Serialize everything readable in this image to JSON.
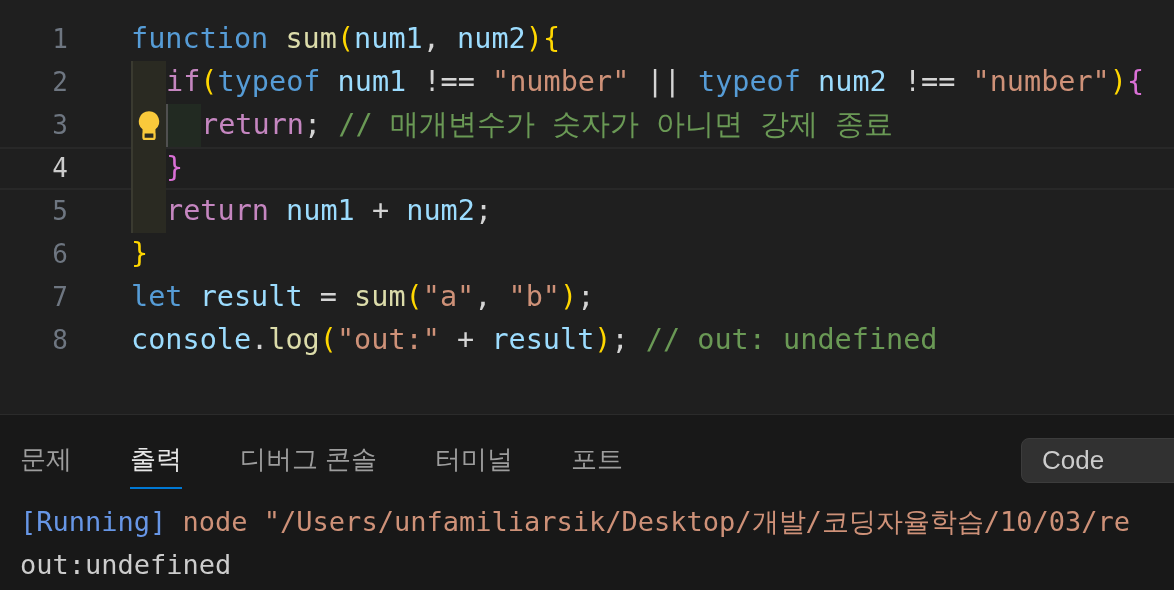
{
  "editor": {
    "lines": [
      {
        "number": "1",
        "current": false,
        "lightbulb": false,
        "tokens": [
          {
            "text": "function ",
            "kind": "keyword"
          },
          {
            "text": "sum",
            "kind": "func"
          },
          {
            "text": "(",
            "kind": "bracket1"
          },
          {
            "text": "num1",
            "kind": "var"
          },
          {
            "text": ", ",
            "kind": "plain"
          },
          {
            "text": "num2",
            "kind": "var"
          },
          {
            "text": ")",
            "kind": "bracket1"
          },
          {
            "text": "{",
            "kind": "bracket1"
          }
        ],
        "children": [
          {
            "number": "2",
            "current": false,
            "lightbulb": false,
            "tokens": [
              {
                "text": "if",
                "kind": "control"
              },
              {
                "text": "(",
                "kind": "bracket1"
              },
              {
                "text": "typeof ",
                "kind": "keyword"
              },
              {
                "text": "num1",
                "kind": "var"
              },
              {
                "text": " !== ",
                "kind": "plain"
              },
              {
                "text": "\"number\"",
                "kind": "string"
              },
              {
                "text": " || ",
                "kind": "plain"
              },
              {
                "text": "typeof ",
                "kind": "keyword"
              },
              {
                "text": "num2",
                "kind": "var"
              },
              {
                "text": " !== ",
                "kind": "plain"
              },
              {
                "text": "\"number\"",
                "kind": "string"
              },
              {
                "text": ")",
                "kind": "bracket1"
              },
              {
                "text": "{",
                "kind": "bracket2"
              }
            ],
            "children": [
              {
                "number": "3",
                "current": false,
                "lightbulb": true,
                "tokens": [
                  {
                    "text": "return",
                    "kind": "control"
                  },
                  {
                    "text": "; ",
                    "kind": "plain"
                  },
                  {
                    "text": "// 매개변수가 숫자가 아니면 강제 종료",
                    "kind": "comment"
                  }
                ]
              }
            ]
          },
          {
            "number": "4",
            "current": true,
            "lightbulb": false,
            "tokens": [
              {
                "text": "}",
                "kind": "bracket2"
              }
            ]
          },
          {
            "number": "5",
            "current": false,
            "lightbulb": false,
            "tokens": [
              {
                "text": "return ",
                "kind": "control"
              },
              {
                "text": "num1",
                "kind": "var"
              },
              {
                "text": " + ",
                "kind": "plain"
              },
              {
                "text": "num2",
                "kind": "var"
              },
              {
                "text": ";",
                "kind": "plain"
              }
            ]
          }
        ]
      },
      {
        "number": "6",
        "current": false,
        "lightbulb": false,
        "tokens": [
          {
            "text": "}",
            "kind": "bracket1"
          }
        ]
      },
      {
        "number": "7",
        "current": false,
        "lightbulb": false,
        "tokens": [
          {
            "text": "let ",
            "kind": "keyword"
          },
          {
            "text": "result",
            "kind": "var"
          },
          {
            "text": " = ",
            "kind": "plain"
          },
          {
            "text": "sum",
            "kind": "func"
          },
          {
            "text": "(",
            "kind": "bracket1"
          },
          {
            "text": "\"a\"",
            "kind": "string"
          },
          {
            "text": ", ",
            "kind": "plain"
          },
          {
            "text": "\"b\"",
            "kind": "string"
          },
          {
            "text": ")",
            "kind": "bracket1"
          },
          {
            "text": ";",
            "kind": "plain"
          }
        ]
      },
      {
        "number": "8",
        "current": false,
        "lightbulb": false,
        "tokens": [
          {
            "text": "console",
            "kind": "var"
          },
          {
            "text": ".",
            "kind": "plain"
          },
          {
            "text": "log",
            "kind": "func"
          },
          {
            "text": "(",
            "kind": "bracket1"
          },
          {
            "text": "\"out:\"",
            "kind": "string"
          },
          {
            "text": " + ",
            "kind": "plain"
          },
          {
            "text": "result",
            "kind": "var"
          },
          {
            "text": ")",
            "kind": "bracket1"
          },
          {
            "text": "; ",
            "kind": "plain"
          },
          {
            "text": "// out: undefined",
            "kind": "comment"
          }
        ]
      }
    ]
  },
  "panel": {
    "tabs": [
      {
        "label": "문제",
        "selected": false
      },
      {
        "label": "출력",
        "selected": true
      },
      {
        "label": "디버그 콘솔",
        "selected": false
      },
      {
        "label": "터미널",
        "selected": false
      },
      {
        "label": "포트",
        "selected": false
      }
    ],
    "channel_select": {
      "value": "Code"
    },
    "output": [
      [
        {
          "text": "[Running]",
          "kind": "info"
        },
        {
          "text": " node \"/Users/unfamiliarsik/Desktop/개발/코딩자율학습/10/03/re",
          "kind": "string"
        }
      ],
      [
        {
          "text": "out:undefined",
          "kind": "plain"
        }
      ]
    ]
  }
}
